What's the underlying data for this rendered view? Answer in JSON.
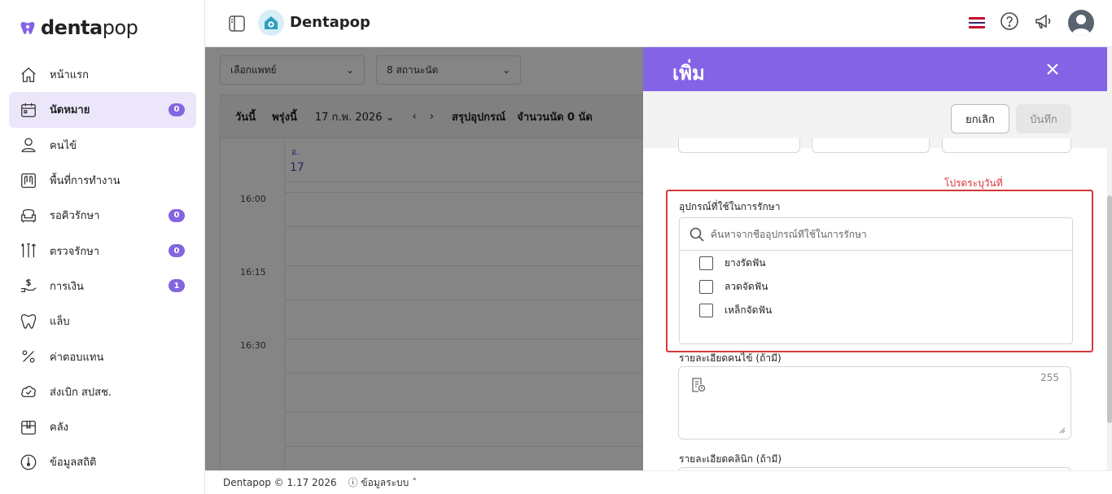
{
  "brand": {
    "name_bold": "denta",
    "name_light": "pop"
  },
  "sidebar": {
    "items": [
      {
        "label": "หน้าแรก",
        "icon": "home-icon"
      },
      {
        "label": "นัดหมาย",
        "icon": "calendar-icon",
        "badge": "0",
        "active": true
      },
      {
        "label": "คนไข้",
        "icon": "user-icon"
      },
      {
        "label": "พื้นที่การทำงาน",
        "icon": "workspace-icon"
      },
      {
        "label": "รอคิวรักษา",
        "icon": "sofa-icon",
        "badge": "0"
      },
      {
        "label": "ตรวจรักษา",
        "icon": "tools-icon",
        "badge": "0"
      },
      {
        "label": "การเงิน",
        "icon": "money-hand-icon",
        "badge": "1"
      },
      {
        "label": "แล็บ",
        "icon": "tooth-icon"
      },
      {
        "label": "ค่าตอบแทน",
        "icon": "percent-icon"
      },
      {
        "label": "ส่งเบิก สปสช.",
        "icon": "cloud-check-icon"
      },
      {
        "label": "คลัง",
        "icon": "box-icon"
      },
      {
        "label": "ข้อมูลสถิติ",
        "icon": "stats-icon"
      }
    ]
  },
  "header": {
    "clinic_name": "Dentapop"
  },
  "main": {
    "doctor_select": "เลือกแพทย์",
    "location_select": "8 สถานะนัด",
    "today": "วันนี้",
    "tomorrow": "พรุ่งนี้",
    "date": "17 ก.พ. 2026",
    "summary": "สรุปอุปกรณ์",
    "appointment_count": "จำนวนนัด 0 นัด",
    "day_of_week": "อ.",
    "day_number": "17",
    "times": [
      "16:00",
      "16:15",
      "16:30"
    ]
  },
  "drawer": {
    "title": "เพิ่ม",
    "cancel_label": "ยกเลิก",
    "save_label": "บันทึก",
    "warning": "โปรดระบุวันที่",
    "equipment_label": "อุปกรณ์ที่ใช้ในการรักษา",
    "equipment_search_placeholder": "ค้นหาจากชื่ออุปกรณ์ที่ใช้ในการรักษา",
    "equipment_options": [
      "ยางรัดฟัน",
      "ลวดจัดฟัน",
      "เหล็กจัดฟัน"
    ],
    "patient_detail_label": "รายละเอียดคนไข้ (ถ้ามี)",
    "patient_detail_counter": "255",
    "clinic_detail_label": "รายละเอียดคลินิก (ถ้ามี)"
  },
  "footer": {
    "copyright": "Dentapop © 1.17 2026",
    "system_info": "ข้อมูลระบบ"
  },
  "colors": {
    "accent": "#8463e6",
    "badge": "#8365e0",
    "warning": "#d9303a"
  }
}
